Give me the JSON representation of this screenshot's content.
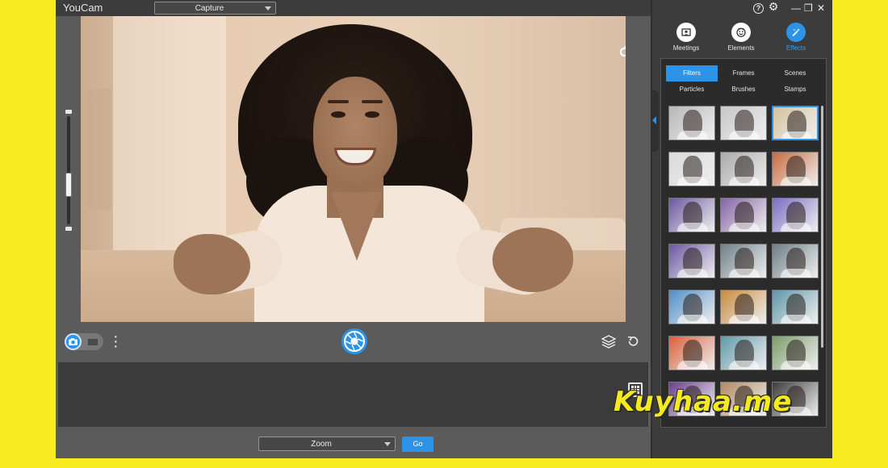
{
  "app": {
    "title": "YouCam"
  },
  "toolbar": {
    "mode_dropdown": "Capture"
  },
  "controls": {
    "mode": "photo"
  },
  "bottom": {
    "zoom_dropdown": "Zoom",
    "go_label": "Go"
  },
  "panel": {
    "nav_tabs": [
      {
        "label": "Meetings",
        "icon": "meetings-icon",
        "active": false
      },
      {
        "label": "Elements",
        "icon": "elements-icon",
        "active": false
      },
      {
        "label": "Effects",
        "icon": "effects-icon",
        "active": true
      }
    ],
    "sub_tabs": [
      {
        "label": "Filters",
        "active": true
      },
      {
        "label": "Frames",
        "active": false
      },
      {
        "label": "Scenes",
        "active": false
      },
      {
        "label": "Particles",
        "active": false
      },
      {
        "label": "Brushes",
        "active": false
      },
      {
        "label": "Stamps",
        "active": false
      }
    ],
    "filter_rows": [
      [
        "#b7b7b7",
        "#c7c7c7",
        "#d4c39d"
      ],
      [
        "#d9d9d9",
        "#a9a9a9",
        "#c96a3e"
      ],
      [
        "#6b58a0",
        "#8563a5",
        "#7b6cc4"
      ],
      [
        "#6a56a3",
        "#6e8088",
        "#6d7f86"
      ],
      [
        "#4f8fc7",
        "#c98a3d",
        "#5f97a8"
      ],
      [
        "#d9613a",
        "#5f9aa8",
        "#7d9d6a"
      ],
      [
        "#6b3f8f",
        "#b28a61",
        "#3b3b3b"
      ]
    ],
    "selected_filter": [
      0,
      2
    ]
  },
  "watermark": {
    "text": "Kuyhaa.me"
  },
  "colors": {
    "accent": "#2d93e7",
    "frame_bg": "#f7ec1f"
  }
}
